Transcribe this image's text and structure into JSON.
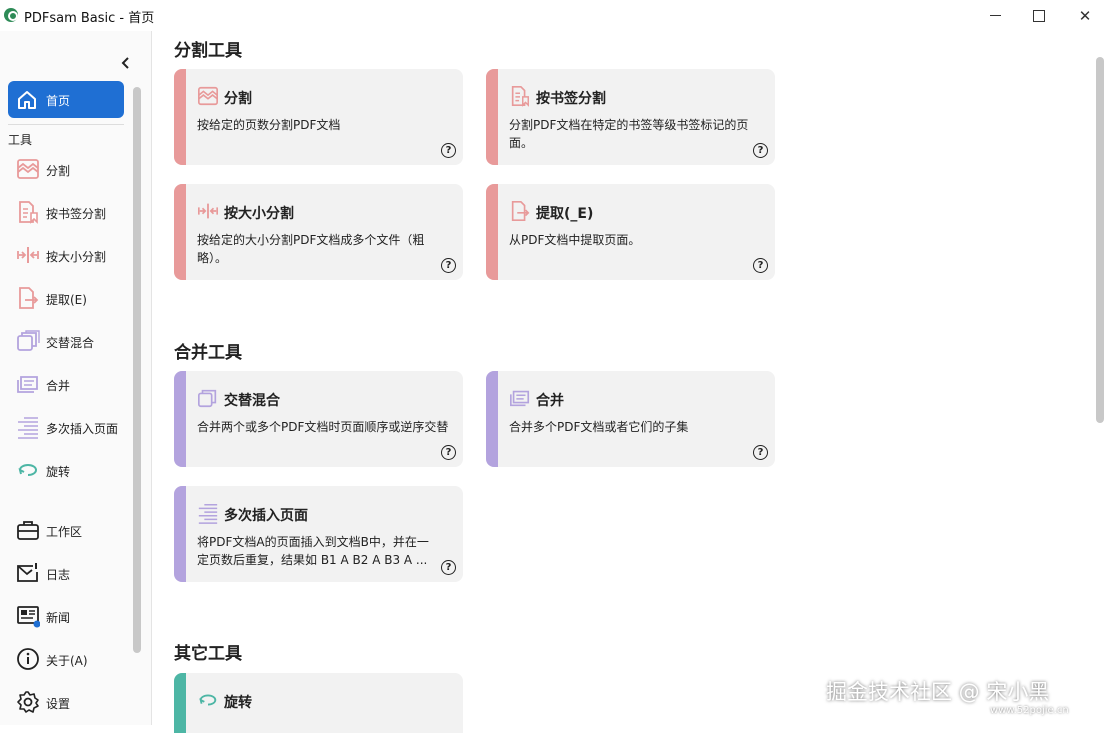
{
  "window": {
    "title": "PDFsam Basic - 首页",
    "controls": [
      "minimize",
      "maximize",
      "close"
    ]
  },
  "sidebar": {
    "home_label": "首页",
    "section_label": "工具",
    "tools": [
      {
        "label": "分割",
        "icon": "split-icon"
      },
      {
        "label": "按书签分割",
        "icon": "bookmark-split-icon"
      },
      {
        "label": "按大小分割",
        "icon": "size-split-icon"
      },
      {
        "label": "提取(E)",
        "icon": "extract-icon"
      },
      {
        "label": "交替混合",
        "icon": "alternate-mix-icon"
      },
      {
        "label": "合并",
        "icon": "merge-icon"
      },
      {
        "label": "多次插入页面",
        "icon": "multi-insert-icon"
      },
      {
        "label": "旋转",
        "icon": "rotate-icon"
      }
    ],
    "bottom": [
      {
        "label": "工作区",
        "icon": "briefcase-icon"
      },
      {
        "label": "日志",
        "icon": "mail-log-icon"
      },
      {
        "label": "新闻",
        "icon": "news-icon"
      },
      {
        "label": "关于(A)",
        "icon": "info-icon"
      },
      {
        "label": "设置",
        "icon": "gear-icon"
      }
    ]
  },
  "main": {
    "sections": [
      {
        "title": "分割工具"
      },
      {
        "title": "合并工具"
      },
      {
        "title": "其它工具"
      }
    ],
    "cards": [
      {
        "title": "分割",
        "desc": "按给定的页数分割PDF文档",
        "icon": "split-icon"
      },
      {
        "title": "按书签分割",
        "desc": "分割PDF文档在特定的书签等级书签标记的页面。",
        "icon": "bookmark-split-icon"
      },
      {
        "title": "按大小分割",
        "desc": "按给定的大小分割PDF文档成多个文件（粗略）。",
        "icon": "size-split-icon"
      },
      {
        "title": "提取(_E)",
        "desc": "从PDF文档中提取页面。",
        "icon": "extract-icon"
      },
      {
        "title": "交替混合",
        "desc": "合并两个或多个PDF文档时页面顺序或逆序交替",
        "icon": "alternate-mix-icon"
      },
      {
        "title": "合并",
        "desc": "合并多个PDF文档或者它们的子集",
        "icon": "merge-icon"
      },
      {
        "title": "多次插入页面",
        "desc": "将PDF文档A的页面插入到文档B中，并在一定页数后重复，结果如 B1 A B2 A B3 A ...",
        "icon": "multi-insert-icon"
      },
      {
        "title": "旋转",
        "desc": "",
        "icon": "rotate-icon"
      }
    ],
    "help_glyph": "?"
  },
  "colors": {
    "split_accent": "#e89a9a",
    "merge_accent": "#b3a3de",
    "other_accent": "#4db6a5",
    "home_active": "#1f6fd3"
  },
  "watermark": {
    "text": "掘金技术社区 @ 宋小黑",
    "sub": "www.52pojie.cn"
  }
}
